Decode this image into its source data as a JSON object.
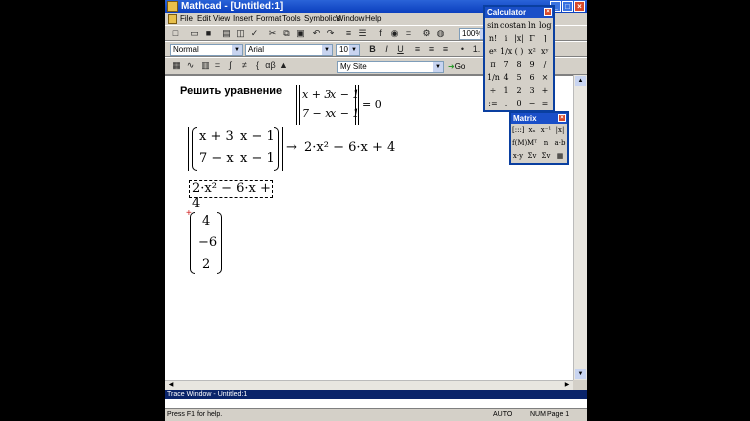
{
  "window": {
    "title": "Mathcad - [Untitled:1]"
  },
  "menu": [
    "File",
    "Edit",
    "View",
    "Insert",
    "Format",
    "Tools",
    "Symbolics",
    "Window",
    "Help"
  ],
  "toolbar": {
    "zoom": "100%"
  },
  "format": {
    "style": "Normal",
    "font": "Arial",
    "size": "10",
    "bold": "B",
    "italic": "I",
    "underline": "U"
  },
  "resources": {
    "site": "My Site",
    "go": "Go"
  },
  "doc": {
    "heading": "Решить уравнение",
    "eq_m11": "x + 3",
    "eq_m12": "x − 1",
    "eq_m21": "7 − x",
    "eq_m22": "x − 1",
    "eq_rhs": "= 0",
    "m11": "x + 3",
    "m12": "x − 1",
    "m21": "7 − x",
    "m22": "x − 1",
    "arrow": "→",
    "result": "2·x² − 6·x + 4",
    "poly": "2·x² − 6·x + 4",
    "vec": [
      "4",
      "−6",
      "2"
    ]
  },
  "calculator": {
    "title": "Calculator",
    "rows": [
      [
        "sin",
        "cos",
        "tan",
        "ln",
        "log"
      ],
      [
        "n!",
        "i",
        "|x|",
        "Γ",
        "⌉"
      ],
      [
        "eˣ",
        "1/x",
        "( )",
        "x²",
        "xʸ"
      ],
      [
        "π",
        "7",
        "8",
        "9",
        "/"
      ],
      [
        "1/n",
        "4",
        "5",
        "6",
        "×"
      ],
      [
        "÷",
        "1",
        "2",
        "3",
        "+"
      ],
      [
        ":=",
        ".",
        "0",
        "−",
        "="
      ]
    ]
  },
  "matrix_palette": {
    "title": "Matrix",
    "rows": [
      [
        "[:::]",
        "xₙ",
        "x⁻¹",
        "|x|"
      ],
      [
        "f(M)",
        "Mᵀ",
        "n",
        "a·b"
      ],
      [
        "x·y",
        "Σv",
        "Σv",
        "▦"
      ]
    ]
  },
  "trace": {
    "title": "Trace Window - Untitled:1"
  },
  "status": {
    "help": "Press F1 for help.",
    "mode": "AUTO",
    "num": "NUM",
    "page": "Page 1"
  }
}
